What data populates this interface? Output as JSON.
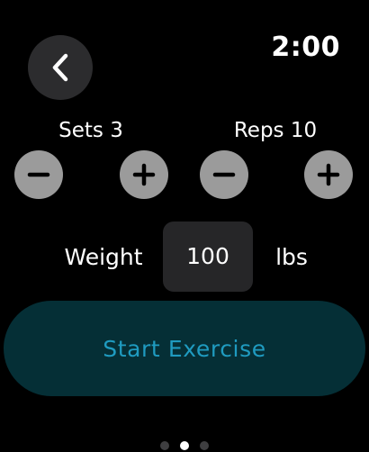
{
  "header": {
    "time": "2:00",
    "back_icon": "chevron-left-icon"
  },
  "sets": {
    "label": "Sets 3",
    "value": 3,
    "decrement_icon": "minus-icon",
    "increment_icon": "plus-icon"
  },
  "reps": {
    "label": "Reps 10",
    "value": 10,
    "decrement_icon": "minus-icon",
    "increment_icon": "plus-icon"
  },
  "weight": {
    "label": "Weight",
    "value": "100",
    "unit": "lbs"
  },
  "start_button": {
    "label": "Start Exercise"
  },
  "page_indicator": {
    "total": 3,
    "current": 2
  },
  "colors": {
    "background": "#000000",
    "button_gray": "#9b9b9b",
    "field_background": "#262628",
    "start_background": "#052f36",
    "start_text": "#1f9bc0"
  }
}
